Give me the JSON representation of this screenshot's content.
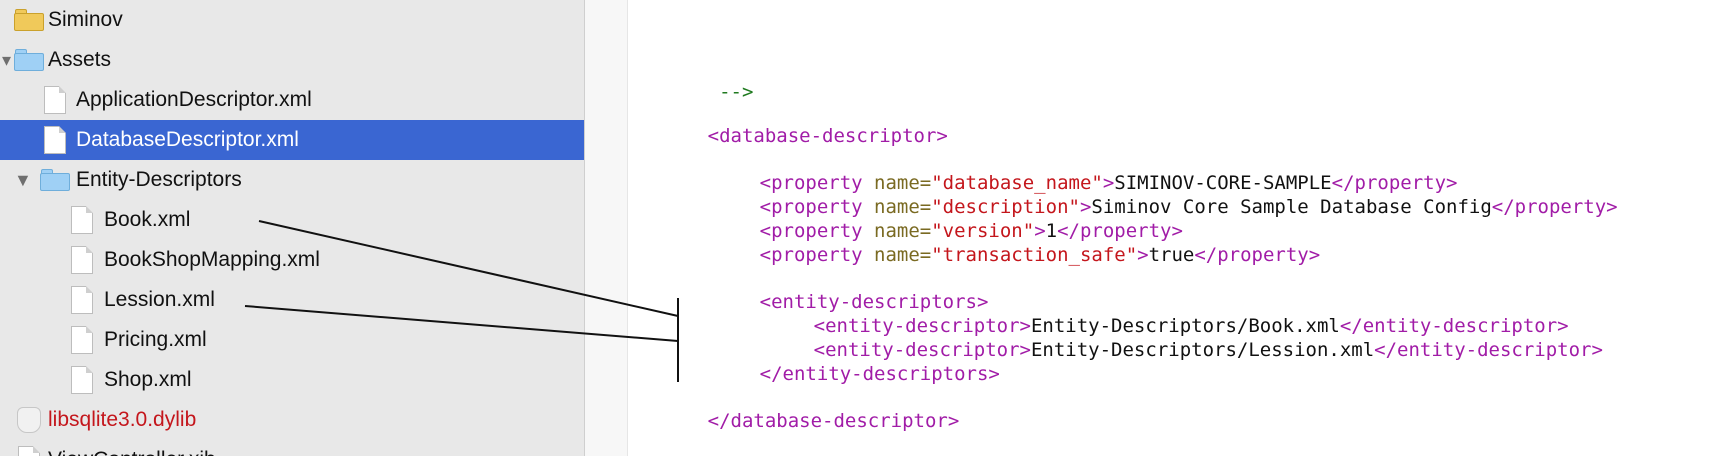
{
  "navigator": {
    "items": [
      {
        "label": "Siminov",
        "type": "folder",
        "color": "yellow",
        "level": 0,
        "selected": false,
        "disclosure": "none"
      },
      {
        "label": "Assets",
        "type": "folder",
        "color": "blue",
        "level": 0,
        "selected": false,
        "disclosure": "expanded-partial"
      },
      {
        "label": "ApplicationDescriptor.xml",
        "type": "file",
        "level": 1,
        "selected": false,
        "disclosure": "none"
      },
      {
        "label": "DatabaseDescriptor.xml",
        "type": "file",
        "level": 1,
        "selected": true,
        "disclosure": "none"
      },
      {
        "label": "Entity-Descriptors",
        "type": "folder",
        "color": "blue",
        "level": 1,
        "selected": false,
        "disclosure": "expanded"
      },
      {
        "label": "Book.xml",
        "type": "file",
        "level": 2,
        "selected": false,
        "disclosure": "none"
      },
      {
        "label": "BookShopMapping.xml",
        "type": "file",
        "level": 2,
        "selected": false,
        "disclosure": "none"
      },
      {
        "label": "Lession.xml",
        "type": "file",
        "level": 2,
        "selected": false,
        "disclosure": "none"
      },
      {
        "label": "Pricing.xml",
        "type": "file",
        "level": 2,
        "selected": false,
        "disclosure": "none"
      },
      {
        "label": "Shop.xml",
        "type": "file",
        "level": 2,
        "selected": false,
        "disclosure": "none"
      },
      {
        "label": "libsqlite3.0.dylib",
        "type": "library",
        "level": 0,
        "selected": false,
        "disclosure": "none",
        "color": "#c4161c"
      },
      {
        "label": "ViewController.xib",
        "type": "file",
        "level": 0,
        "selected": false,
        "disclosure": "none"
      }
    ]
  },
  "editor": {
    "lines": [
      {
        "kind": "comment",
        "text": " -->"
      },
      {
        "kind": "tag",
        "text": "<database-descriptor>"
      },
      {
        "kind": "property",
        "open": "<property ",
        "attr": "name=",
        "value": "\"database_name\"",
        "text": "SIMINOV-CORE-SAMPLE",
        "close": "</property>"
      },
      {
        "kind": "property",
        "open": "<property ",
        "attr": "name=",
        "value": "\"description\"",
        "text": "Siminov Core Sample Database Config",
        "close": "</property>"
      },
      {
        "kind": "property",
        "open": "<property ",
        "attr": "name=",
        "value": "\"version\"",
        "text": "1",
        "close": "</property>"
      },
      {
        "kind": "property",
        "open": "<property ",
        "attr": "name=",
        "value": "\"transaction_safe\"",
        "text": "true",
        "close": "</property>"
      },
      {
        "kind": "tag",
        "text": "<entity-descriptors>"
      },
      {
        "kind": "element",
        "open": "<entity-descriptor>",
        "text": "Entity-Descriptors/Book.xml",
        "close": "</entity-descriptor>"
      },
      {
        "kind": "element",
        "open": "<entity-descriptor>",
        "text": "Entity-Descriptors/Lession.xml",
        "close": "</entity-descriptor>"
      },
      {
        "kind": "tag",
        "text": "</entity-descriptors>"
      },
      {
        "kind": "tag",
        "text": "</database-descriptor>"
      }
    ]
  },
  "colors": {
    "selected_row": "#3a66d2",
    "tag": "#a11ca7",
    "attribute": "#7a6a22",
    "value": "#c4161c",
    "comment": "#1f7a1f",
    "text": "#111111"
  }
}
